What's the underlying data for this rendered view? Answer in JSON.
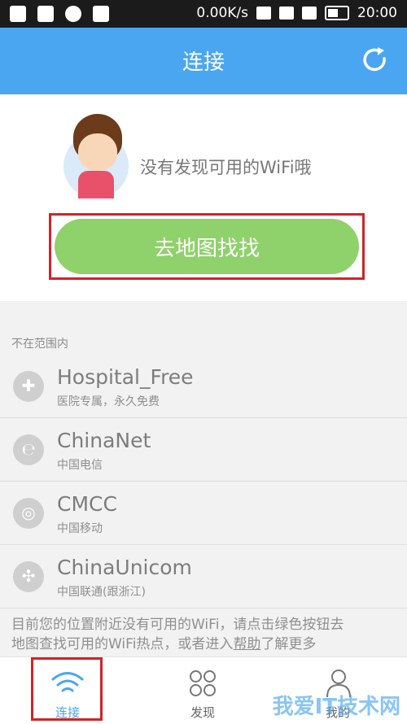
{
  "status_bar": {
    "speed": "0.00K/s",
    "time": "20:00"
  },
  "header": {
    "title": "连接"
  },
  "empty_state": {
    "message": "没有发现可用的WiFi哦",
    "button_label": "去地图找找"
  },
  "section_label": "不在范围内",
  "networks": [
    {
      "name": "Hospital_Free",
      "desc": "医院专属，永久免费",
      "icon": "hospital-icon"
    },
    {
      "name": "ChinaNet",
      "desc": "中国电信",
      "icon": "chinanet-icon"
    },
    {
      "name": "CMCC",
      "desc": "中国移动",
      "icon": "cmcc-icon"
    },
    {
      "name": "ChinaUnicom",
      "desc": "中国联通(跟浙江)",
      "icon": "chinaunicom-icon"
    }
  ],
  "info": {
    "line1": "目前您的位置附近没有可用的WiFi，请点击绿色按钮去",
    "line2_pre": "地图查找可用的WiFi热点，或者进入",
    "link": "帮助",
    "line2_post": "了解更多"
  },
  "bottom_nav": {
    "connect": "连接",
    "discover": "发现",
    "me": "我的"
  },
  "watermark": "我爱IT技术网",
  "colors": {
    "primary": "#4aa6f0",
    "green": "#8fd16b",
    "highlight": "#d32228"
  }
}
